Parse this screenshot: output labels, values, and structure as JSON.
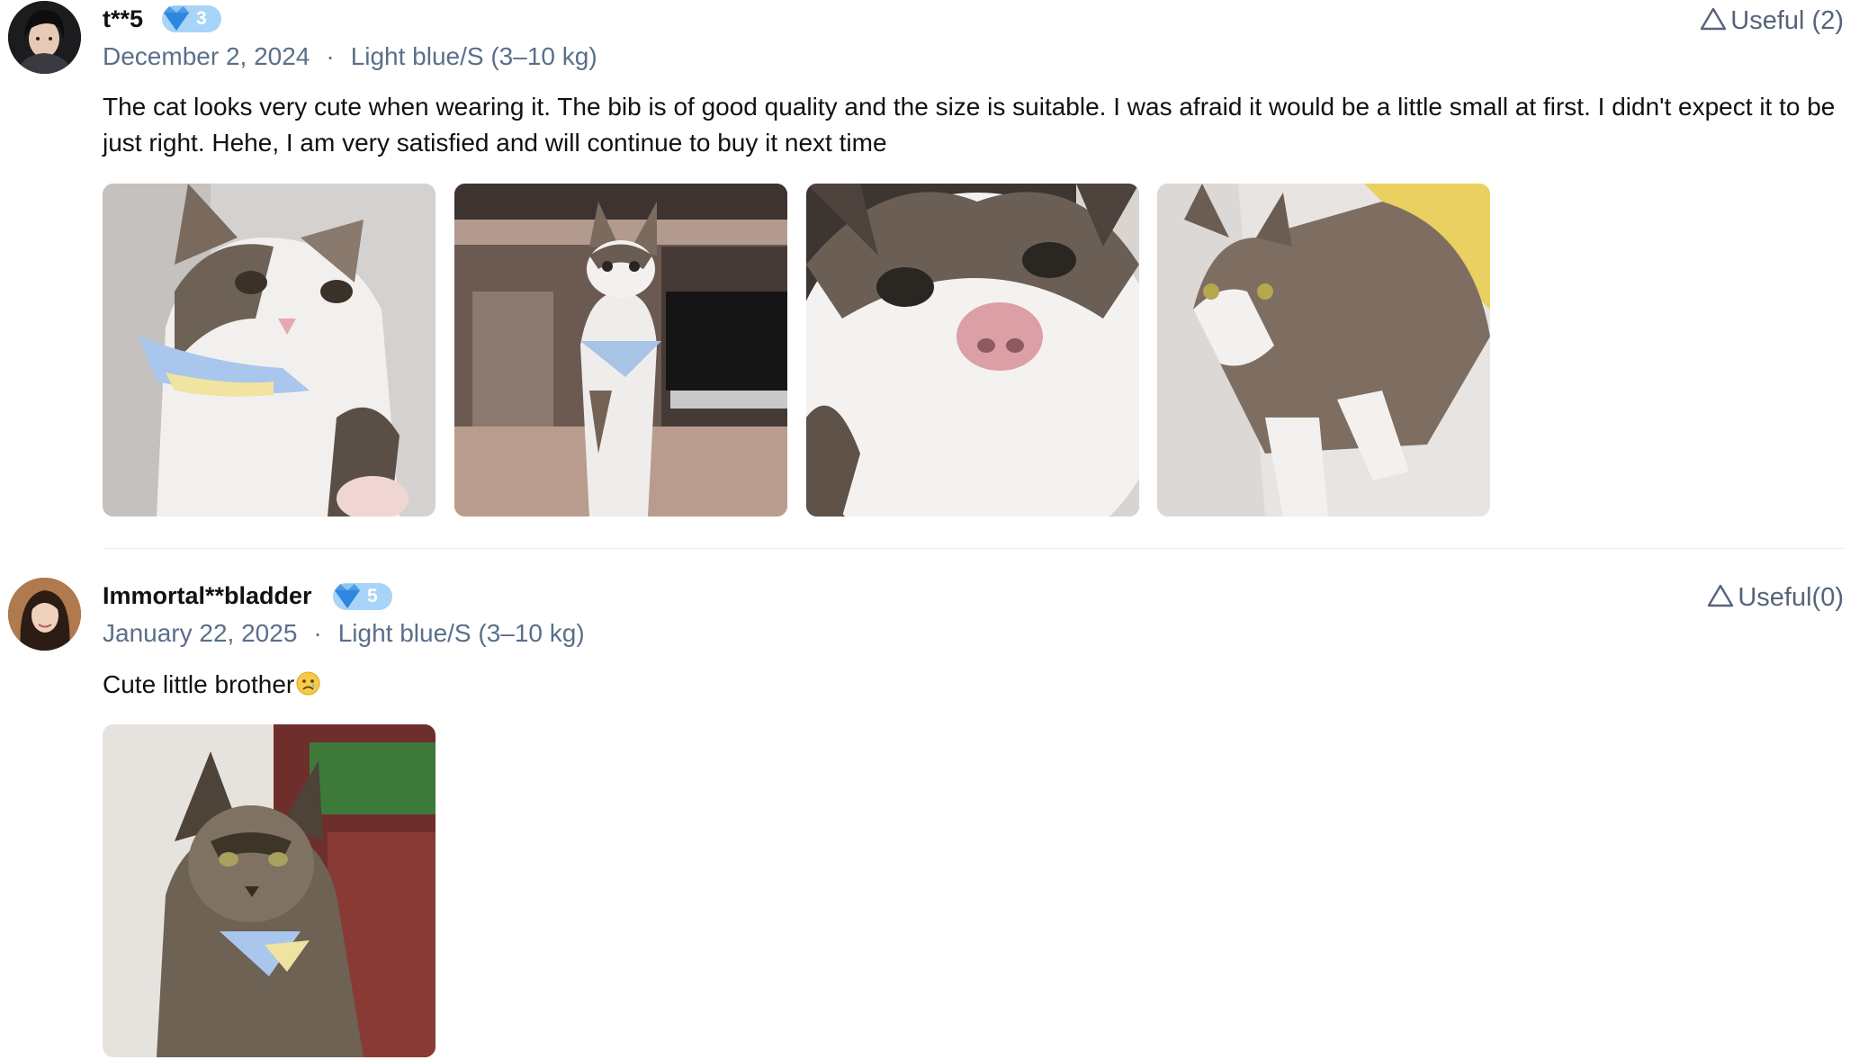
{
  "reviews": [
    {
      "username": "t**5",
      "level": "3",
      "date": "December 2, 2024",
      "separator": "·",
      "variant": "Light blue/S (3–10 kg)",
      "useful_label": "Useful (2)",
      "text": "The cat looks very cute when wearing it. The bib is of good quality and the size is suitable. I was afraid it would be a little small at first. I didn't expect it to be just right. Hehe, I am very satisfied and will continue to buy it next time",
      "photos": [
        "photo-cat-closeup-bib",
        "photo-cat-sitting-desk",
        "photo-cat-face-closeup",
        "photo-cat-walking"
      ]
    },
    {
      "username": "Immortal**bladder",
      "level": "5",
      "date": "January 22, 2025",
      "separator": "·",
      "variant": "Light blue/S (3–10 kg)",
      "useful_label": "Useful(0)",
      "text": "Cute little brother",
      "emoji": "crying-face-emoji",
      "photos": [
        "photo-maine-coon-bib"
      ]
    }
  ],
  "colors": {
    "meta": "#5a6f8a",
    "badge": "#a8d4f7",
    "diamond": "#4a9be8",
    "divider": "#ececec"
  },
  "icons": {
    "useful": "triangle-outline-icon",
    "level": "diamond-icon"
  }
}
